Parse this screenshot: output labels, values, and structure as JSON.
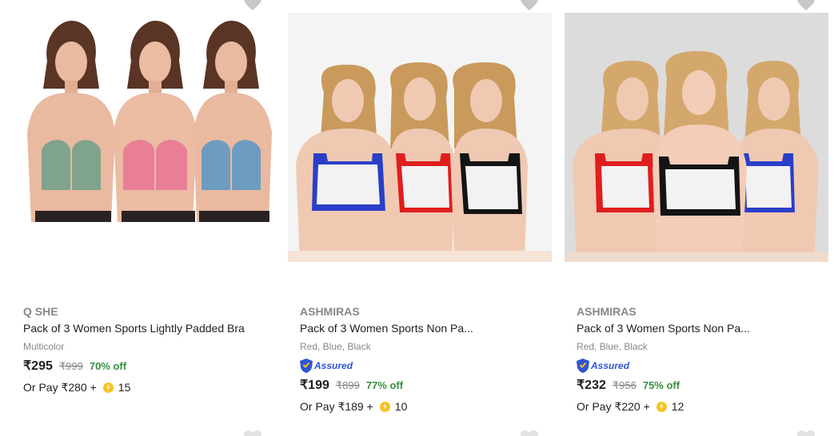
{
  "products": [
    {
      "brand": "Q SHE",
      "title": "Pack of 3 Women Sports Lightly Padded Bra",
      "color": "Multicolor",
      "assured": false,
      "assured_label": "",
      "price": "₹295",
      "mrp": "₹999",
      "discount": "70% off",
      "pay_prefix": "Or Pay ₹280 +",
      "coins": "15",
      "image_bg": "#ffffff",
      "bra_colors": [
        "#7fa38c",
        "#e87f96",
        "#6e9cc0"
      ]
    },
    {
      "brand": "ASHMIRAS",
      "title": "Pack of 3 Women Sports Non Pa...",
      "color": "Red, Blue, Black",
      "assured": true,
      "assured_label": "Assured",
      "price": "₹199",
      "mrp": "₹899",
      "discount": "77% off",
      "pay_prefix": "Or Pay ₹189 +",
      "coins": "10",
      "image_bg": "#f0f0f0",
      "bra_colors": [
        "#2a3fc8",
        "#e01e1e",
        "#141414"
      ]
    },
    {
      "brand": "ASHMIRAS",
      "title": "Pack of 3 Women Sports Non Pa...",
      "color": "Red, Blue, Black",
      "assured": true,
      "assured_label": "Assured",
      "price": "₹232",
      "mrp": "₹956",
      "discount": "75% off",
      "pay_prefix": "Or Pay ₹220 +",
      "coins": "12",
      "image_bg": "#dcdcdc",
      "bra_colors": [
        "#e01e1e",
        "#141414",
        "#2a3fc8"
      ]
    }
  ],
  "icons": {
    "wishlist": "heart-icon",
    "assured": "flipkart-assured-icon",
    "coin": "supercoin-icon"
  },
  "colors": {
    "brand_gray": "#878787",
    "discount_green": "#388e3c",
    "assured_blue": "#2f54d6",
    "coin_yellow": "#f7c325"
  }
}
